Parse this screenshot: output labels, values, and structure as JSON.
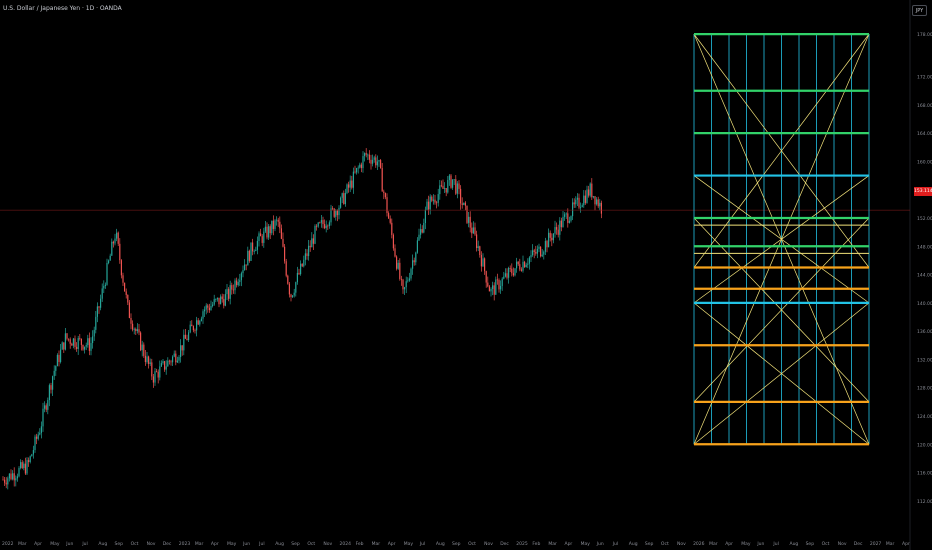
{
  "header": {
    "symbol_title": "U.S. Dollar / Japanese Yen · 1D · OANDA",
    "currency_button": "JPY"
  },
  "price_badge": {
    "value": "153.114"
  },
  "colors": {
    "background": "#000000",
    "candle_up": "#26a69a",
    "candle_down": "#ef5350",
    "current_price_line": "#8b1e1e",
    "price_badge": "#e01e1e",
    "grid_box_green": "#32d26a",
    "grid_box_cyan": "#22c3e6",
    "grid_box_orange": "#f7a21b",
    "grid_box_diagonal": "#f2e27a",
    "axis_text": "#8a8d96"
  },
  "chart_data": {
    "type": "candlestick",
    "title": "U.S. Dollar / Japanese Yen · 1D · OANDA",
    "xlabel": "",
    "ylabel": "",
    "ylim": [
      110,
      180
    ],
    "y_ticks": [
      "178.000",
      "172.000",
      "168.000",
      "164.000",
      "160.000",
      "156.000",
      "152.000",
      "148.000",
      "144.000",
      "140.000",
      "136.000",
      "132.000",
      "128.000",
      "124.000",
      "120.000",
      "116.000",
      "112.000"
    ],
    "x_ticks": [
      "2022",
      "Mar",
      "Apr",
      "May",
      "Jun",
      "Jul",
      "Aug",
      "Sep",
      "Oct",
      "Nov",
      "Dec",
      "2023",
      "Mar",
      "Apr",
      "May",
      "Jun",
      "Jul",
      "Aug",
      "Sep",
      "Oct",
      "Nov",
      "2024",
      "Feb",
      "Mar",
      "Apr",
      "May",
      "Jul",
      "Aug",
      "Sep",
      "Oct",
      "Nov",
      "Dec",
      "2025",
      "Feb",
      "Mar",
      "Apr",
      "May",
      "Jun",
      "Jul",
      "Aug",
      "Sep",
      "Oct",
      "Nov",
      "2026",
      "Mar",
      "Apr",
      "May",
      "Jun",
      "Jul",
      "Aug",
      "Sep",
      "Oct",
      "Nov",
      "Dec",
      "2027",
      "Mar",
      "Apr"
    ],
    "current_price": 153.114,
    "price_path_approx": [
      {
        "date": "2022-01",
        "close": 115.0
      },
      {
        "date": "2022-03",
        "close": 117.0
      },
      {
        "date": "2022-04",
        "close": 122.5
      },
      {
        "date": "2022-05",
        "close": 130.0
      },
      {
        "date": "2022-06",
        "close": 135.0
      },
      {
        "date": "2022-08",
        "close": 134.0
      },
      {
        "date": "2022-10",
        "close": 150.0
      },
      {
        "date": "2022-11",
        "close": 139.0
      },
      {
        "date": "2023-01",
        "close": 129.5
      },
      {
        "date": "2023-03",
        "close": 133.0
      },
      {
        "date": "2023-05",
        "close": 139.0
      },
      {
        "date": "2023-07",
        "close": 141.0
      },
      {
        "date": "2023-09",
        "close": 148.0
      },
      {
        "date": "2023-11",
        "close": 151.5
      },
      {
        "date": "2023-12",
        "close": 141.0
      },
      {
        "date": "2024-02",
        "close": 150.0
      },
      {
        "date": "2024-04",
        "close": 154.0
      },
      {
        "date": "2024-06",
        "close": 161.0
      },
      {
        "date": "2024-07",
        "close": 160.0
      },
      {
        "date": "2024-09",
        "close": 141.0
      },
      {
        "date": "2024-11",
        "close": 154.0
      },
      {
        "date": "2025-01",
        "close": 157.5
      },
      {
        "date": "2025-03",
        "close": 148.0
      },
      {
        "date": "2025-04",
        "close": 141.5
      },
      {
        "date": "2025-06",
        "close": 145.0
      },
      {
        "date": "2025-08",
        "close": 147.5
      },
      {
        "date": "2025-10",
        "close": 152.0
      },
      {
        "date": "2025-12",
        "close": 156.0
      },
      {
        "date": "2026-01",
        "close": 153.1
      }
    ],
    "grid_box": {
      "top_price": 178.0,
      "bottom_price": 120.0,
      "levels": [
        {
          "price": 178.0,
          "color": "green"
        },
        {
          "price": 170.0,
          "color": "green"
        },
        {
          "price": 164.0,
          "color": "green"
        },
        {
          "price": 158.0,
          "color": "cyan"
        },
        {
          "price": 152.0,
          "color": "green"
        },
        {
          "price": 151.0,
          "color": "yellow"
        },
        {
          "price": 148.0,
          "color": "green"
        },
        {
          "price": 147.0,
          "color": "yellow"
        },
        {
          "price": 145.0,
          "color": "orange"
        },
        {
          "price": 142.0,
          "color": "orange"
        },
        {
          "price": 140.0,
          "color": "cyan"
        },
        {
          "price": 134.0,
          "color": "orange"
        },
        {
          "price": 126.0,
          "color": "orange"
        },
        {
          "price": 120.0,
          "color": "orange"
        }
      ]
    }
  }
}
